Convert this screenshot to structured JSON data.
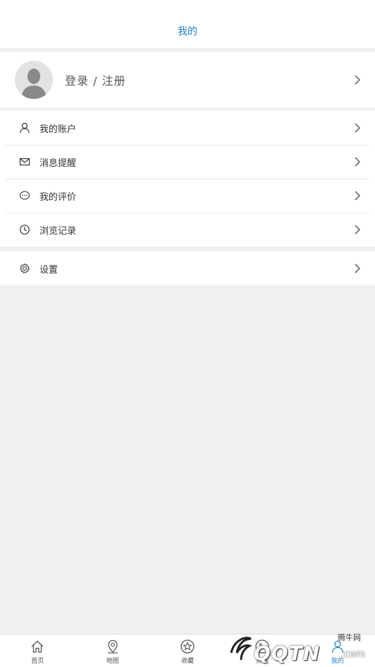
{
  "header": {
    "title": "我的"
  },
  "profile": {
    "login_label": "登录 / 注册"
  },
  "menu": {
    "items": [
      {
        "label": "我的账户",
        "icon": "user-icon"
      },
      {
        "label": "消息提醒",
        "icon": "mail-icon"
      },
      {
        "label": "我的评价",
        "icon": "comment-icon"
      },
      {
        "label": "浏览记录",
        "icon": "clock-icon"
      }
    ],
    "settings": {
      "label": "设置",
      "icon": "gear-icon"
    }
  },
  "tabbar": {
    "tabs": [
      {
        "label": "首页",
        "icon": "home-icon"
      },
      {
        "label": "地图",
        "icon": "map-pin-icon"
      },
      {
        "label": "收藏",
        "icon": "star-icon"
      },
      {
        "label": "热线",
        "icon": "phone-icon"
      },
      {
        "label": "我的",
        "icon": "user-icon",
        "active": true
      }
    ]
  },
  "watermark": {
    "small": "腾牛网",
    "big": "QQTN",
    "suffix": ".com"
  },
  "colors": {
    "accent": "#1f7fc9",
    "background": "#f0f0f0"
  }
}
